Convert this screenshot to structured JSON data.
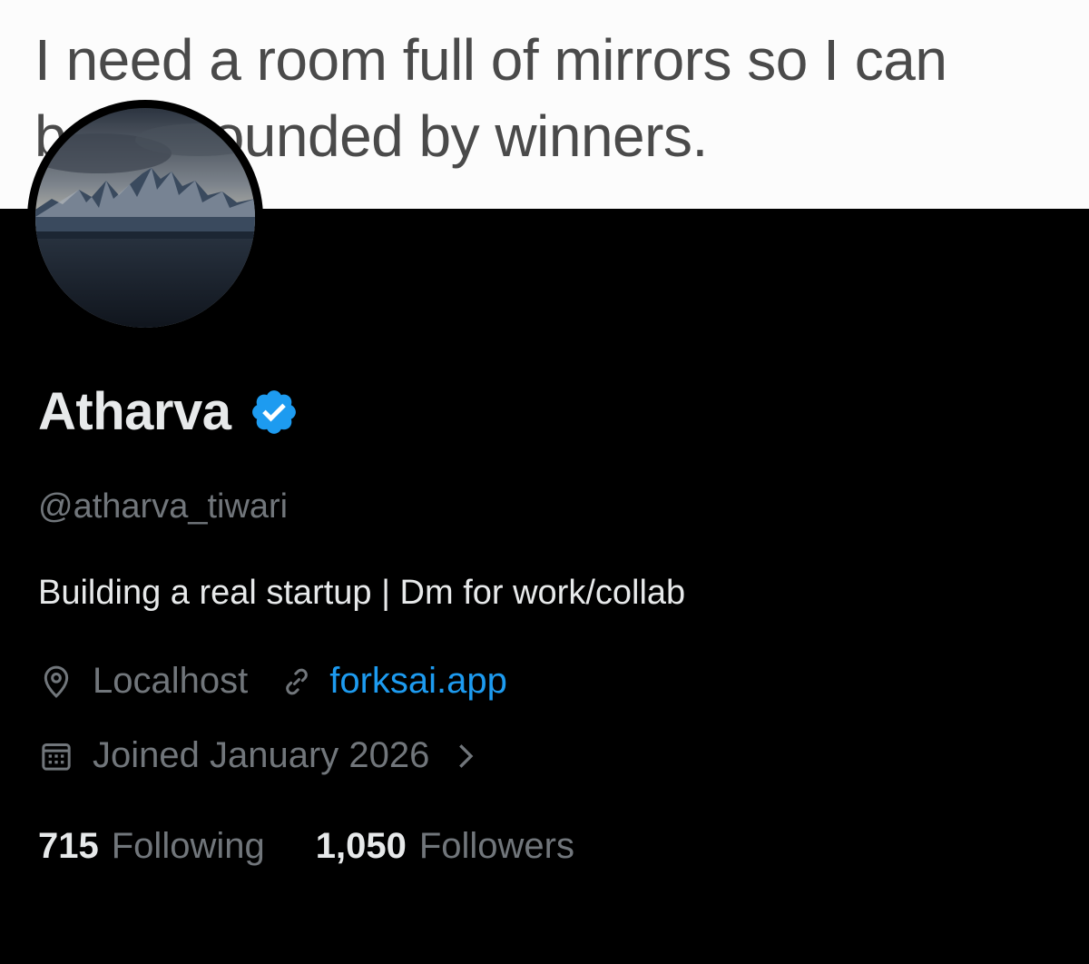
{
  "banner": {
    "text": "I need a room full of mirrors so I can\nbe surrounded by winners."
  },
  "profile": {
    "display_name": "Atharva",
    "handle": "@atharva_tiwari",
    "bio": "Building a real startup | Dm for work/collab",
    "location": "Localhost",
    "website": "forksai.app",
    "joined": "Joined January 2026"
  },
  "stats": {
    "following_count": "715",
    "following_label": "Following",
    "followers_count": "1,050",
    "followers_label": "Followers"
  },
  "icons": {
    "verified": "verified-badge-icon",
    "location": "location-pin-icon",
    "link": "link-icon",
    "calendar": "calendar-icon",
    "chevron": "chevron-right-icon"
  },
  "colors": {
    "background": "#000000",
    "primary_text": "#e7e9ea",
    "secondary_text": "#71767b",
    "accent": "#1d9bf0"
  }
}
